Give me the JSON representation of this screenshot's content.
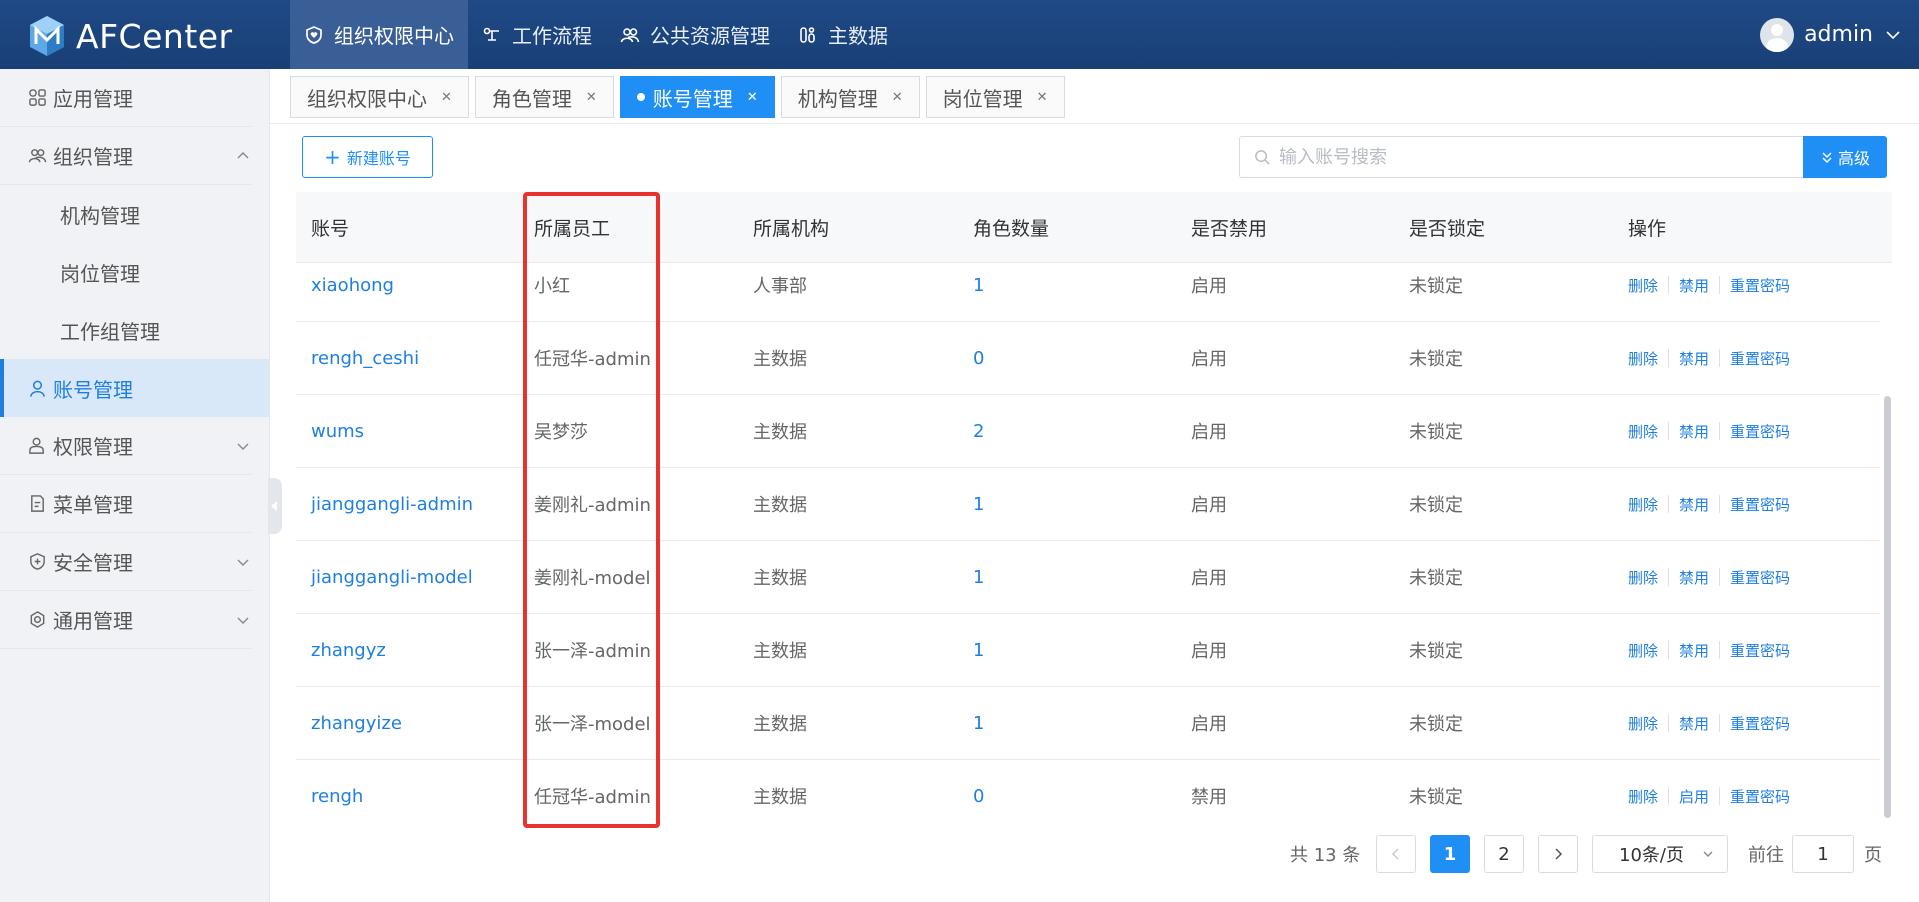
{
  "app": {
    "name": "AFCenter"
  },
  "topnav": [
    {
      "label": "组织权限中心",
      "icon": "shield-heart-icon",
      "active": true
    },
    {
      "label": "工作流程",
      "icon": "workflow-icon",
      "active": false
    },
    {
      "label": "公共资源管理",
      "icon": "users-icon",
      "active": false
    },
    {
      "label": "主数据",
      "icon": "data-icon",
      "active": false
    }
  ],
  "user": {
    "name": "admin"
  },
  "sidebar": {
    "items": [
      {
        "label": "应用管理"
      },
      {
        "label": "组织管理"
      },
      {
        "label": "机构管理"
      },
      {
        "label": "岗位管理"
      },
      {
        "label": "工作组管理"
      },
      {
        "label": "账号管理"
      },
      {
        "label": "权限管理"
      },
      {
        "label": "菜单管理"
      },
      {
        "label": "安全管理"
      },
      {
        "label": "通用管理"
      }
    ]
  },
  "tabs": [
    {
      "label": "组织权限中心"
    },
    {
      "label": "角色管理"
    },
    {
      "label": "账号管理"
    },
    {
      "label": "机构管理"
    },
    {
      "label": "岗位管理"
    }
  ],
  "toolbar": {
    "new_label": "新建账号",
    "search_placeholder": "输入账号搜索",
    "advanced_label": "高级"
  },
  "table": {
    "columns": [
      "账号",
      "所属员工",
      "所属机构",
      "角色数量",
      "是否禁用",
      "是否锁定",
      "操作"
    ],
    "rows": [
      {
        "account": "xiaohong",
        "employee": "小红",
        "org": "人事部",
        "roles": "1",
        "disabled": "启用",
        "locked": "未锁定",
        "toggle": "禁用"
      },
      {
        "account": "rengh_ceshi",
        "employee": "任冠华-admin",
        "org": "主数据",
        "roles": "0",
        "disabled": "启用",
        "locked": "未锁定",
        "toggle": "禁用"
      },
      {
        "account": "wums",
        "employee": "吴梦莎",
        "org": "主数据",
        "roles": "2",
        "disabled": "启用",
        "locked": "未锁定",
        "toggle": "禁用"
      },
      {
        "account": "jianggangli-admin",
        "employee": "姜刚礼-admin",
        "org": "主数据",
        "roles": "1",
        "disabled": "启用",
        "locked": "未锁定",
        "toggle": "禁用"
      },
      {
        "account": "jianggangli-model",
        "employee": "姜刚礼-model",
        "org": "主数据",
        "roles": "1",
        "disabled": "启用",
        "locked": "未锁定",
        "toggle": "禁用"
      },
      {
        "account": "zhangyz",
        "employee": "张一泽-admin",
        "org": "主数据",
        "roles": "1",
        "disabled": "启用",
        "locked": "未锁定",
        "toggle": "禁用"
      },
      {
        "account": "zhangyize",
        "employee": "张一泽-model",
        "org": "主数据",
        "roles": "1",
        "disabled": "启用",
        "locked": "未锁定",
        "toggle": "禁用"
      },
      {
        "account": "rengh",
        "employee": "任冠华-admin",
        "org": "主数据",
        "roles": "0",
        "disabled": "禁用",
        "locked": "未锁定",
        "toggle": "启用"
      }
    ],
    "action_delete": "删除",
    "action_reset": "重置密码"
  },
  "pagination": {
    "total": "共 13 条",
    "pages": [
      "1",
      "2"
    ],
    "page_size": "10条/页",
    "goto_prefix": "前往",
    "goto_value": "1",
    "goto_suffix": "页"
  },
  "colors": {
    "primary": "#1f8ff5",
    "header": "#1f4a86",
    "highlight": "#e8322e"
  }
}
